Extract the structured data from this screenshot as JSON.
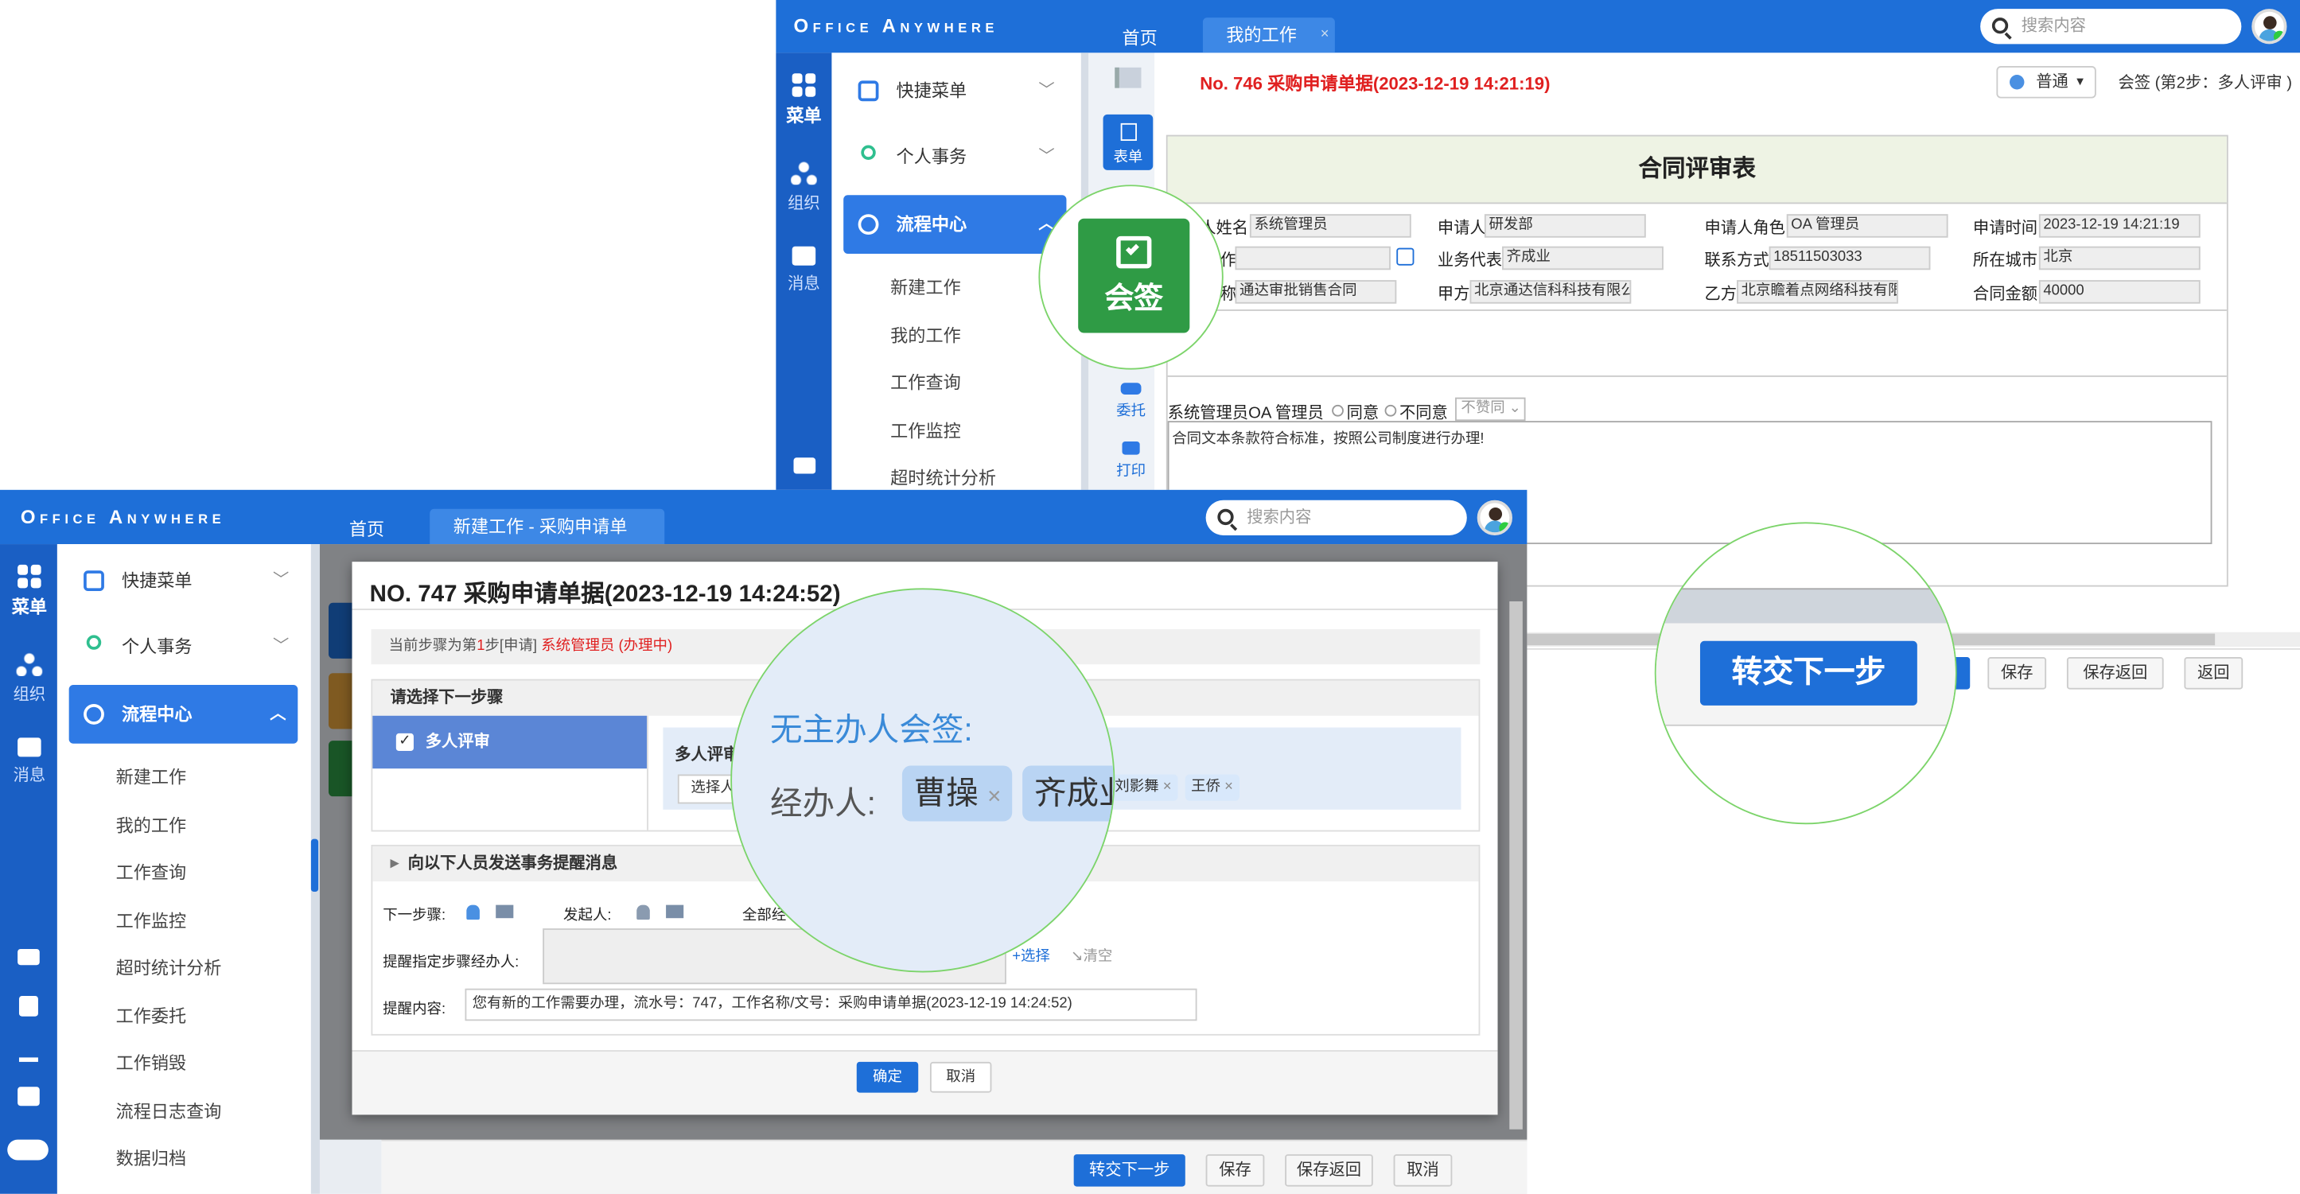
{
  "app": {
    "logo": "Office Anywhere"
  },
  "back_window": {
    "tabs": [
      "首页",
      "我的工作"
    ],
    "tab_close": "×",
    "search_placeholder": "搜索内容",
    "rail": [
      "菜单",
      "组织",
      "消息"
    ],
    "menu": {
      "groups": [
        "快捷菜单",
        "个人事务",
        "流程中心"
      ],
      "items": [
        "新建工作",
        "我的工作",
        "工作查询",
        "工作监控",
        "超时统计分析"
      ]
    },
    "side_tools": [
      "表单",
      "委托",
      "打印"
    ],
    "doc_title": "No. 746 采购申请单据(2023-12-19 14:21:19)",
    "priority": "普通",
    "step_info": "会签 (第2步：多人评审 )",
    "form": {
      "title": "合同评审表",
      "labels": [
        "人姓名",
        "申请人",
        "申请人角色",
        "申请时间",
        "作",
        "业务代表",
        "联系方式",
        "所在城市",
        "称",
        "甲方",
        "乙方",
        "合同金额"
      ],
      "values": [
        "系统管理员",
        "研发部",
        "OA 管理员",
        "2023-12-19 14:21:19",
        "",
        "齐成业",
        "18511503033",
        "北京",
        "通达审批销售合同",
        "北京通达信科科技有限公",
        "北京瞻着点网络科技有限",
        "40000"
      ],
      "opinion_label": "系统管理员OA 管理员",
      "agree": "同意",
      "disagree": "不同意",
      "select": "不赞同",
      "opinion_text": "合同文本条款符合标准，按照公司制度进行办理!"
    },
    "buttons": [
      "保存",
      "保存返回",
      "返回"
    ],
    "zoom_sign": "会签",
    "zoom_next": "转交下一步"
  },
  "front_window": {
    "tabs": [
      "首页",
      "新建工作 - 采购申请单据"
    ],
    "tab_close": "×",
    "search_placeholder": "搜索内容",
    "rail": [
      "菜单",
      "组织",
      "消息"
    ],
    "menu": {
      "groups": [
        "快捷菜单",
        "个人事务",
        "流程中心"
      ],
      "items": [
        "新建工作",
        "我的工作",
        "工作查询",
        "工作监控",
        "超时统计分析",
        "工作委托",
        "工作销毁",
        "流程日志查询",
        "数据归档"
      ]
    },
    "bottom_buttons": [
      "转交下一步",
      "保存",
      "保存返回",
      "取消"
    ]
  },
  "dialog": {
    "title": "NO. 747 采购申请单据(2023-12-19 14:24:52)",
    "current_prefix": "当前步骤为第",
    "current_num": "1",
    "current_mid": "步[申请] ",
    "current_user": "系统管理员 (办理中)",
    "choose_step": "请选择下一步骤",
    "step_option": "多人评审",
    "step_detail_title": "多人评审",
    "select_label": "选择人",
    "handlers": [
      "刘影舞",
      "王侨"
    ],
    "remind_title": "向以下人员发送事务提醒消息",
    "next_step_label": "下一步骤:",
    "initiator_label": "发起人:",
    "all_label": "全部经",
    "assign_label": "提醒指定步骤经办人:",
    "select_link": "选择",
    "clear_link": "清空",
    "content_label": "提醒内容:",
    "content_value": "您有新的工作需要办理，流水号：747，工作名称/文号：采购申请单据(2023-12-19 14:24:52)",
    "ok": "确定",
    "cancel": "取消",
    "zoom_title": "无主办人会签:",
    "zoom_handler_label": "经办人:",
    "zoom_tags": [
      "曹操",
      "齐成业"
    ]
  },
  "colors": {
    "brand": "#1e6fd8",
    "danger": "#e02020",
    "highlight_ring": "#7cd46a",
    "sign_green": "#2f9b45"
  }
}
